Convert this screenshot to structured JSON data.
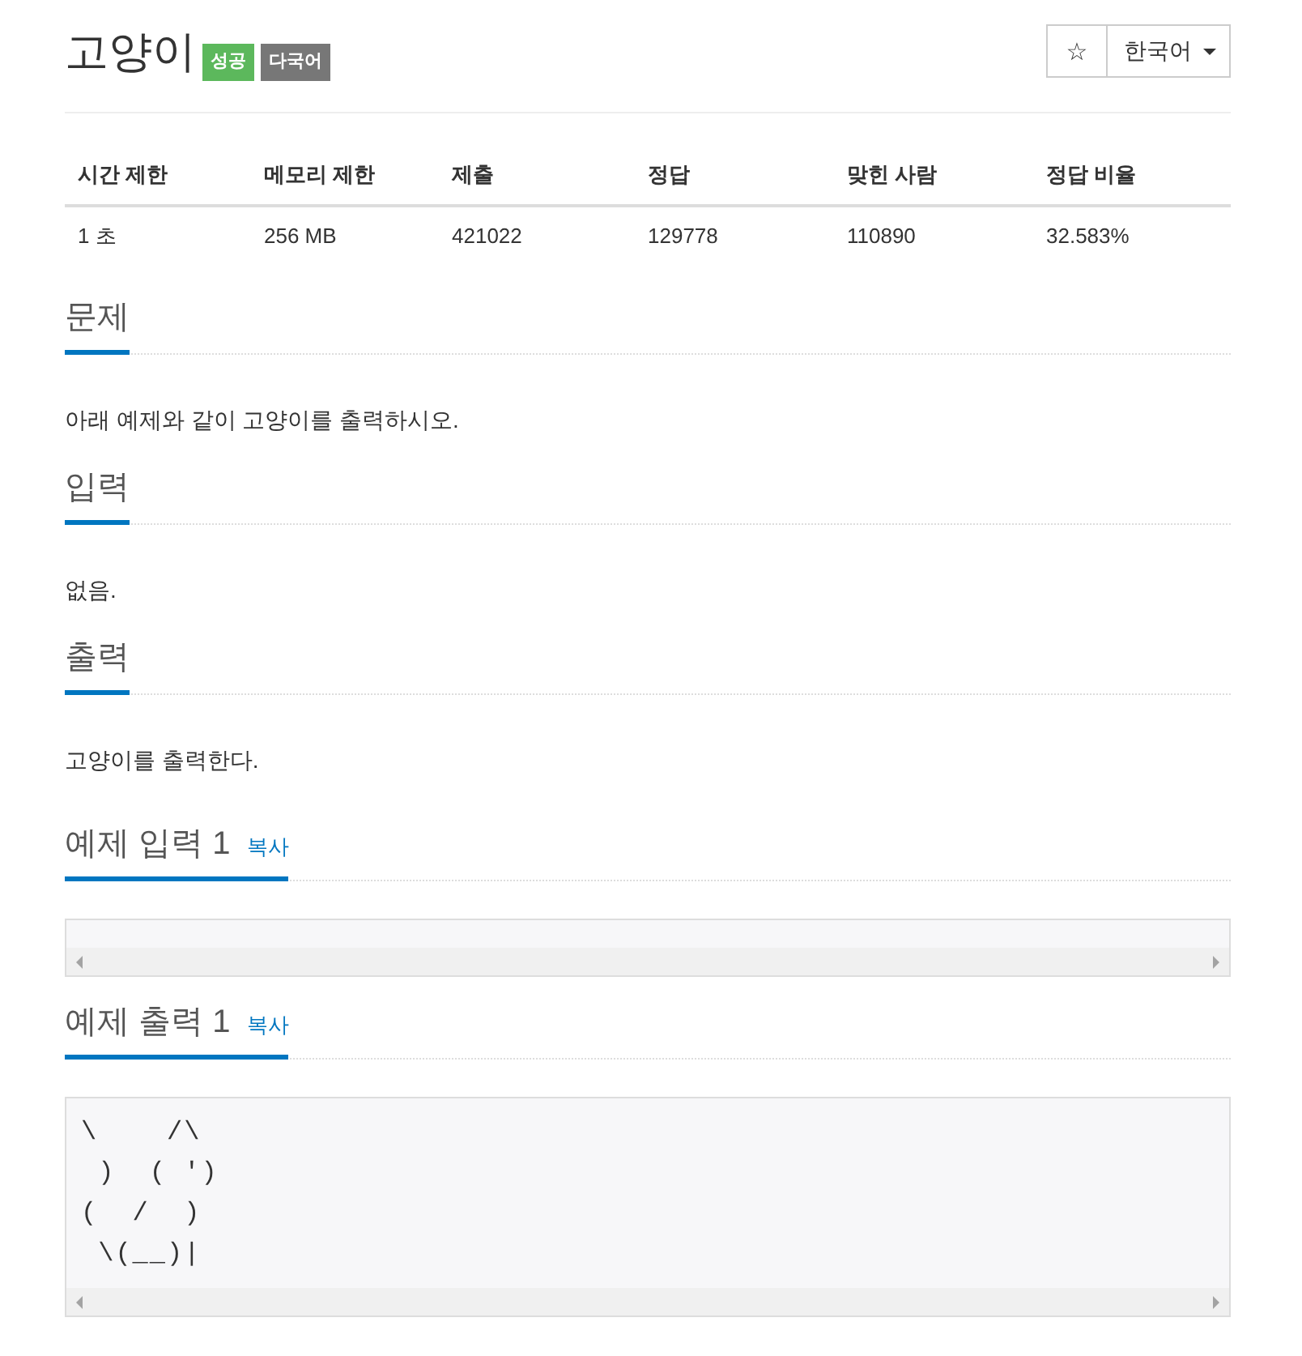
{
  "header": {
    "title": "고양이",
    "badges": [
      {
        "label": "성공",
        "color": "#5cb85c"
      },
      {
        "label": "다국어",
        "color": "#777777"
      }
    ],
    "star": "☆",
    "language": "한국어"
  },
  "info_table": {
    "columns": [
      "시간 제한",
      "메모리 제한",
      "제출",
      "정답",
      "맞힌 사람",
      "정답 비율"
    ],
    "rows": [
      [
        "1 초",
        "256 MB",
        "421022",
        "129778",
        "110890",
        "32.583%"
      ]
    ]
  },
  "sections": [
    {
      "kind": "text",
      "heading": "문제",
      "text": "아래 예제와 같이 고양이를 출력하시오."
    },
    {
      "kind": "text",
      "heading": "입력",
      "text": "없음."
    },
    {
      "kind": "text",
      "heading": "출력",
      "text": "고양이를 출력한다."
    },
    {
      "kind": "sample",
      "heading": "예제 입력 1",
      "copy": "복사"
    },
    {
      "kind": "sample",
      "heading": "예제 출력 1",
      "copy": "복사",
      "lines": [
        "\\    /\\",
        " )  ( ')",
        "(  /  )",
        " \\(__)|"
      ]
    }
  ]
}
